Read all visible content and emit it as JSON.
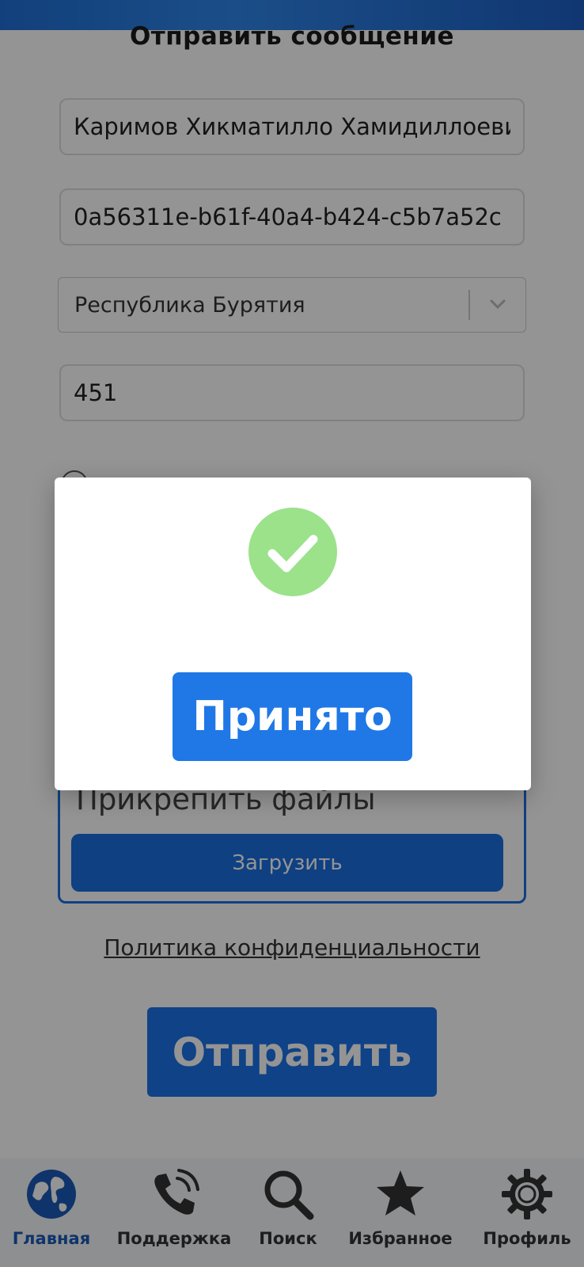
{
  "form": {
    "title": "Отправить сообщение",
    "name_value": "Каримов Хикматилло Хамидиллоевич",
    "id_value": "0a56311e-b61f-40a4-b424-c5b7a52c",
    "region_selected": "Республика Бурятия",
    "code_value": "451",
    "attach_caption": "Прикрепить файлы",
    "upload_label": "Загрузить",
    "policy_link": "Политика конфиденциальности",
    "submit_label": "Отправить"
  },
  "modal": {
    "status_icon": "success-check-icon",
    "accept_label": "Принято",
    "colors": {
      "check_circle": "#9be28b",
      "button": "#1f78e6"
    }
  },
  "bottom_nav": {
    "items": [
      {
        "label": "Главная",
        "icon": "globe-icon",
        "active": true
      },
      {
        "label": "Поддержка",
        "icon": "phone-icon",
        "active": false
      },
      {
        "label": "Поиск",
        "icon": "search-icon",
        "active": false
      },
      {
        "label": "Избранное",
        "icon": "star-icon",
        "active": false
      },
      {
        "label": "Профиль",
        "icon": "gear-icon",
        "active": false
      }
    ]
  },
  "colors": {
    "accent": "#1a6fe0",
    "nav_active": "#1a5bb8"
  }
}
